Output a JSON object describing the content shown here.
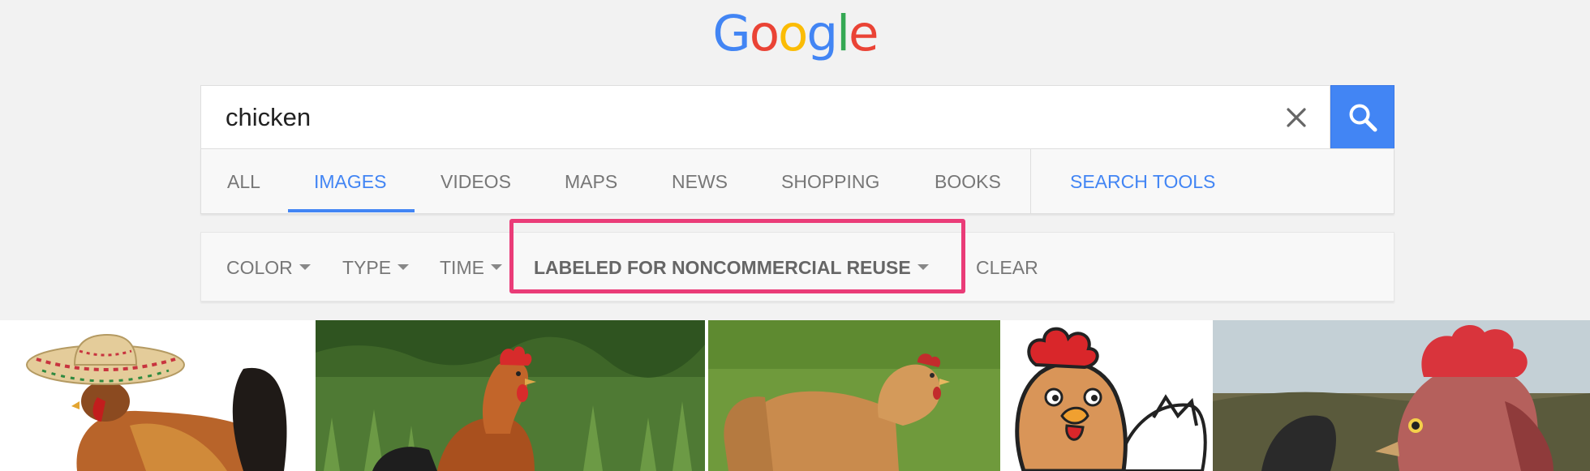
{
  "logo": {
    "letters": [
      "G",
      "o",
      "o",
      "g",
      "l",
      "e"
    ],
    "colors": [
      "#4285f4",
      "#ea4335",
      "#fbbc05",
      "#4285f4",
      "#34a853",
      "#ea4335"
    ]
  },
  "search": {
    "query": "chicken",
    "clear_icon": "close-icon",
    "submit_icon": "search-icon"
  },
  "tabs": [
    {
      "label": "ALL",
      "active": false
    },
    {
      "label": "IMAGES",
      "active": true
    },
    {
      "label": "VIDEOS",
      "active": false
    },
    {
      "label": "MAPS",
      "active": false
    },
    {
      "label": "NEWS",
      "active": false
    },
    {
      "label": "SHOPPING",
      "active": false
    },
    {
      "label": "BOOKS",
      "active": false
    }
  ],
  "search_tools_label": "SEARCH TOOLS",
  "filters": {
    "color": "COLOR",
    "type": "TYPE",
    "time": "TIME",
    "usage_rights": "LABELED FOR NONCOMMERCIAL REUSE",
    "clear": "CLEAR"
  },
  "colors": {
    "accent": "#4285f4",
    "highlight": "#ea3c78"
  },
  "results": [
    {
      "subject": "rooster-with-sombrero"
    },
    {
      "subject": "rooster-in-grass"
    },
    {
      "subject": "hen-on-lawn"
    },
    {
      "subject": "cartoon-chicken"
    },
    {
      "subject": "rooster-head-closeup"
    }
  ]
}
